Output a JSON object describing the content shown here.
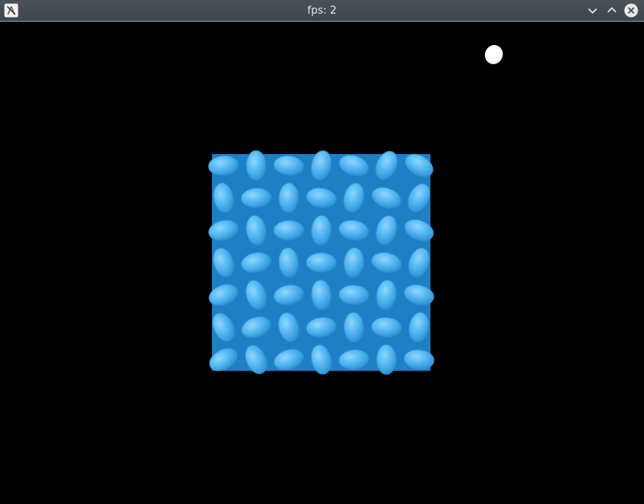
{
  "window": {
    "title": "fps: 2",
    "titlebar_color": "#454c52",
    "accent_border": "#6fa8c8"
  },
  "titlebar_buttons": [
    {
      "name": "minimize-button",
      "icon": "chevron-down-icon"
    },
    {
      "name": "maximize-button",
      "icon": "chevron-up-icon"
    },
    {
      "name": "close-button",
      "icon": "close-icon"
    }
  ],
  "scene": {
    "background": "#000000",
    "object_color": "#4fb4ee",
    "object_shadow_color": "#1f7fc4",
    "light_marker_color": "#ffffff",
    "grid_rows": 7,
    "grid_cols": 7
  }
}
